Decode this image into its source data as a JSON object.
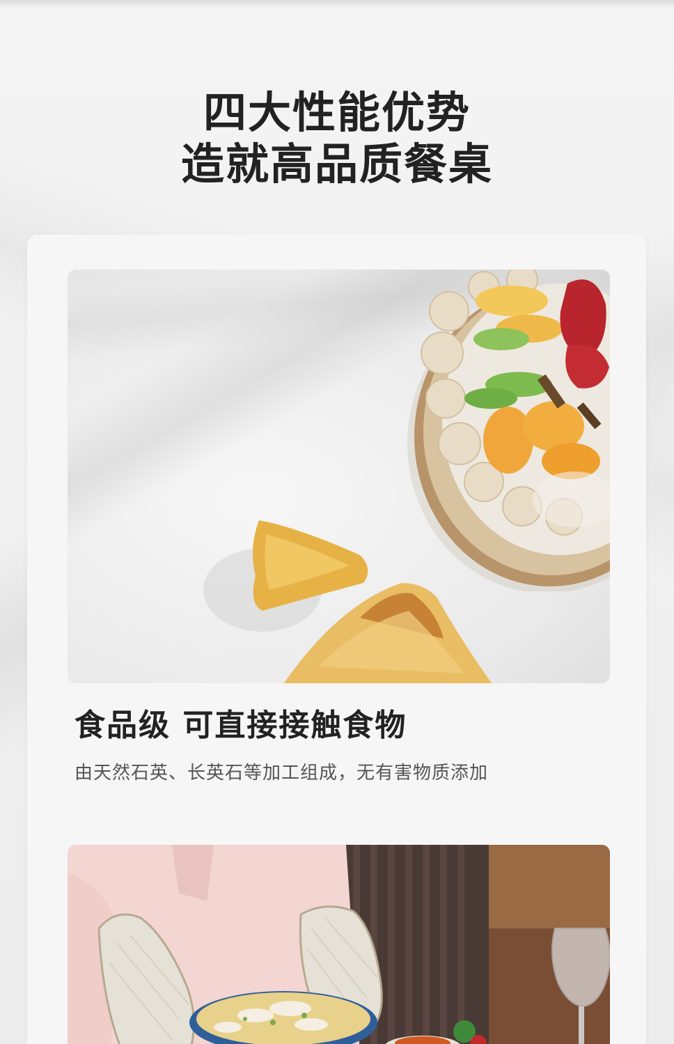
{
  "headline": {
    "line1": "四大性能优势",
    "line2": "造就高品质餐桌"
  },
  "feature": {
    "title": "食品级 可直接接触食物",
    "description": "由天然石英、长英石等加工组成，无有害物质添加"
  },
  "images": {
    "photo1": "cake-and-pastry-photo",
    "photo2": "oven-mitts-serving-bowl-photo"
  },
  "colors": {
    "background": "#f0f0f0",
    "card": "#f6f6f6",
    "title_text": "#222222",
    "desc_text": "#555555"
  }
}
